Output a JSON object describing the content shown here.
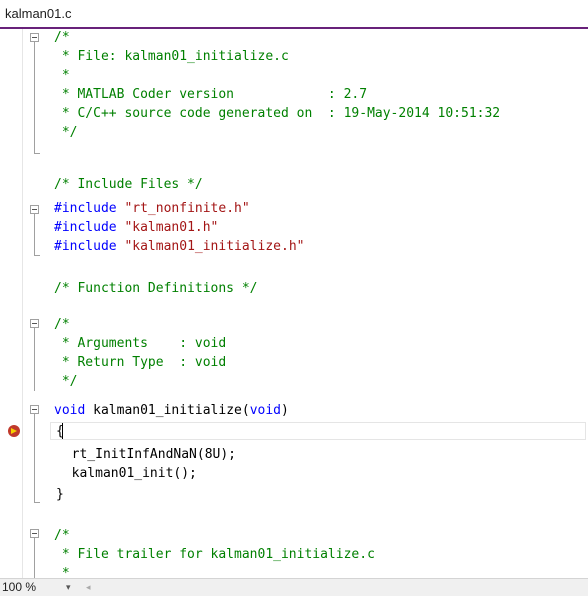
{
  "tab": {
    "title": "kalman01.c"
  },
  "code_lines": [
    "/*",
    " * File: kalman01_initialize.c",
    " *",
    " * MATLAB Coder version            : 2.7",
    " * C/C++ source code generated on  : 19-May-2014 10:51:32",
    " */",
    "",
    "/* Include Files */",
    "#include \"rt_nonfinite.h\"",
    "#include \"kalman01.h\"",
    "#include \"kalman01_initialize.h\"",
    "",
    "/* Function Definitions */",
    "",
    "/*",
    " * Arguments    : void",
    " * Return Type  : void",
    " */",
    "void kalman01_initialize(void)",
    "{",
    "  rt_InitInfAndNaN(8U);",
    "  kalman01_init();",
    "}",
    "",
    "/*",
    " * File trailer for kalman01_initialize.c",
    " *"
  ],
  "tokens": {
    "include_kw": "#include",
    "inc1": "\"rt_nonfinite.h\"",
    "inc2": "\"kalman01.h\"",
    "inc3": "\"kalman01_initialize.h\"",
    "void_kw": "void",
    "func_sig": " kalman01_initialize(",
    "void_arg": "void",
    "close_paren": ")"
  },
  "status": {
    "zoom": "100 %",
    "zoom_dropdown": "▾",
    "scroll_left": "◂"
  },
  "colors": {
    "comment": "#008000",
    "keyword": "#0000ff",
    "string": "#a31515",
    "accent": "#68217a"
  },
  "icons": {
    "breakpoint": "breakpoint-current-statement-icon",
    "fold": "collapse-region-icon"
  }
}
